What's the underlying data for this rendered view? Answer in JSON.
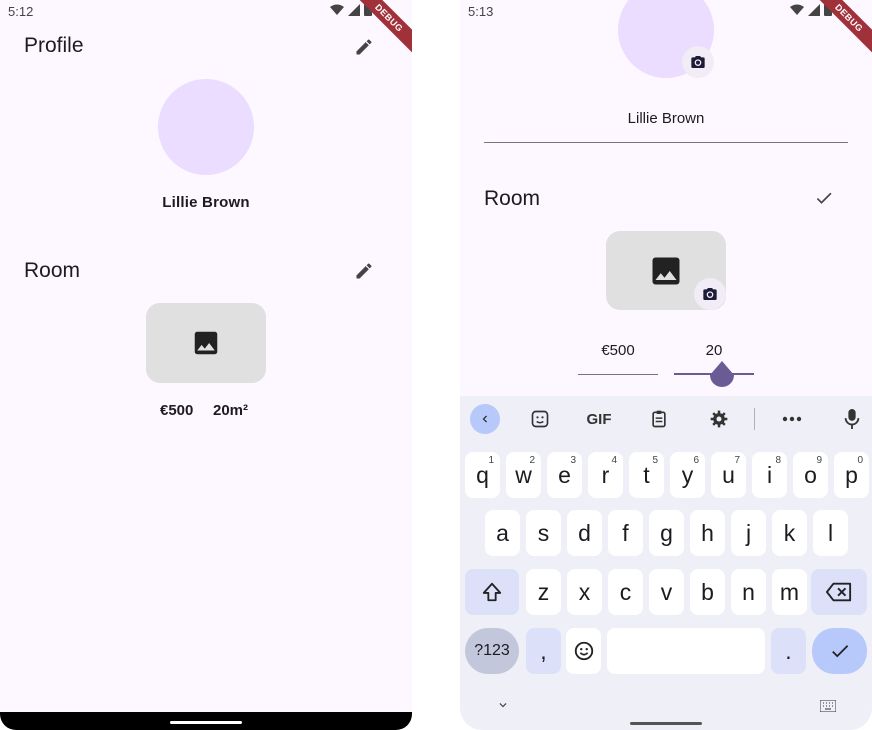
{
  "left": {
    "status_time": "5:12",
    "debug_label": "DEBUG",
    "profile_title": "Profile",
    "user_name": "Lillie Brown",
    "room_title": "Room",
    "price": "€500",
    "area": "20m²"
  },
  "right": {
    "status_time": "5:13",
    "debug_label": "DEBUG",
    "name_field_value": "Lillie Brown",
    "room_title": "Room",
    "price_field_value": "€500",
    "area_field_value": "20",
    "slider_fill_fraction": 0.6,
    "keyboard": {
      "toolbar": [
        "back-icon",
        "sticker-icon",
        "GIF",
        "clipboard-icon",
        "settings-icon",
        "more-icon",
        "mic-icon"
      ],
      "gif_label": "GIF",
      "row1": [
        {
          "k": "q",
          "h": "1"
        },
        {
          "k": "w",
          "h": "2"
        },
        {
          "k": "e",
          "h": "3"
        },
        {
          "k": "r",
          "h": "4"
        },
        {
          "k": "t",
          "h": "5"
        },
        {
          "k": "y",
          "h": "6"
        },
        {
          "k": "u",
          "h": "7"
        },
        {
          "k": "i",
          "h": "8"
        },
        {
          "k": "o",
          "h": "9"
        },
        {
          "k": "p",
          "h": "0"
        }
      ],
      "row2": [
        "a",
        "s",
        "d",
        "f",
        "g",
        "h",
        "j",
        "k",
        "l"
      ],
      "row3": [
        "z",
        "x",
        "c",
        "v",
        "b",
        "n",
        "m"
      ],
      "sym_label": "?123",
      "comma_label": ",",
      "period_label": "."
    }
  },
  "colors": {
    "background": "#fdf7ff",
    "avatar": "#eaddff",
    "accent": "#6b5b95",
    "key_mod": "#dce1f9",
    "key_done": "#b7c8fb"
  }
}
